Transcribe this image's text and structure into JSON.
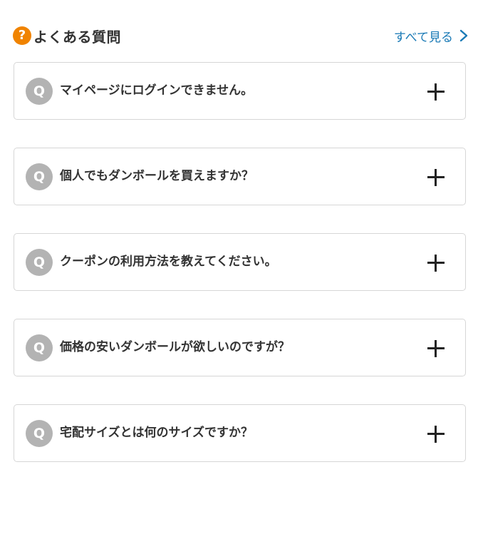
{
  "header": {
    "icon": "help-circle-icon",
    "icon_glyph": "?",
    "title": "よくある質問",
    "see_all_label": "すべて見る",
    "see_all_icon": "chevron-right-icon"
  },
  "faq": {
    "badge": "Q",
    "expand_icon": "plus-icon",
    "items": [
      {
        "question": "マイページにログインできません。"
      },
      {
        "question": "個人でもダンボールを買えますか？"
      },
      {
        "question": "クーポンの利用方法を教えてください。"
      },
      {
        "question": "価格の安いダンボールが欲しいのですが？"
      },
      {
        "question": "宅配サイズとは何のサイズですか？"
      }
    ]
  },
  "colors": {
    "accent_orange": "#f08300",
    "link_blue": "#1a7ab6",
    "badge_gray": "#b3b3b3",
    "border": "#d6d6d6",
    "text": "#333333"
  }
}
